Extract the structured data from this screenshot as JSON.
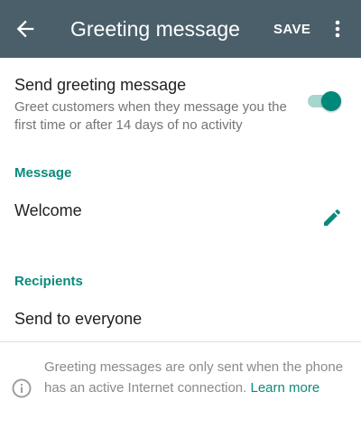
{
  "appbar": {
    "title": "Greeting message",
    "save_label": "SAVE",
    "back_icon": "arrow-back-icon",
    "overflow_icon": "more-vert-icon",
    "background_color": "#4a5f6a"
  },
  "greeting_setting": {
    "title": "Send greeting message",
    "description": "Greet customers when they message you the first time or after 14 days of no activity",
    "enabled": true
  },
  "message_section": {
    "header": "Message",
    "text": "Welcome",
    "edit_icon": "pencil-icon"
  },
  "recipients_section": {
    "header": "Recipients",
    "value": "Send to everyone"
  },
  "footer": {
    "note": "Greeting messages are only sent when the phone has an active Internet connection.",
    "link_label": "Learn more",
    "icon": "info-icon"
  },
  "colors": {
    "accent": "#00897b",
    "section_header": "#0b8a7c"
  }
}
